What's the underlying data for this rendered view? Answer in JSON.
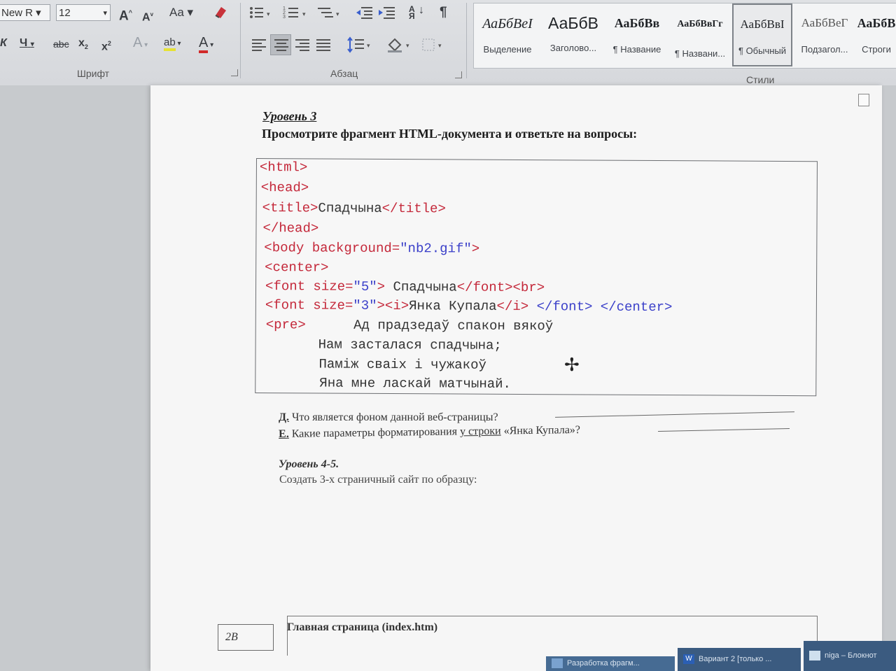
{
  "ribbon": {
    "font_name": "New R",
    "font_size": "12",
    "grow_font": "A",
    "shrink_font": "A",
    "change_case": "Aa",
    "underline": "Ч",
    "strike": "abc",
    "subscript": "x",
    "superscript": "x",
    "text_effects": "A",
    "highlight": "ab",
    "font_color": "A",
    "pilcrow": "¶",
    "font_group_label": "Шрифт",
    "paragraph_group_label": "Абзац",
    "styles_group_label": "Стили",
    "styles": [
      {
        "sample": "АаБбВеI",
        "name": "Выделение"
      },
      {
        "sample": "АаБбВ",
        "name": "Заголово..."
      },
      {
        "sample": "АаБбВв",
        "name": "¶ Название"
      },
      {
        "sample": "АаБбВвГг",
        "name": "¶ Названи..."
      },
      {
        "sample": "АаБбВвI",
        "name": "¶ Обычный"
      },
      {
        "sample": "АаБбВеГ",
        "name": "Подзагол..."
      },
      {
        "sample": "АаБбВ",
        "name": "Строги"
      }
    ]
  },
  "document": {
    "level3": "Уровень 3",
    "instruction": "Просмотрите фрагмент HTML-документа   и ответьте на вопросы:",
    "code": {
      "l1_tag": "<html>",
      "l2_tag": "<head>",
      "l3_open": "<title>",
      "l3_text": "Спадчына",
      "l3_close": "</title>",
      "l4_tag": "</head>",
      "l5_open": "<body ",
      "l5_attr": "background=",
      "l5_val": "\"nb2.gif\"",
      "l5_close": ">",
      "l6_tag": "<center>",
      "l7_open": "<font ",
      "l7_attr": "size=",
      "l7_val": "\"5\"",
      "l7_gt": ">",
      "l7_text": " Спадчына",
      "l7_close": "</font><br>",
      "l8_open": "<font ",
      "l8_attr": "size=",
      "l8_val": "\"3\"",
      "l8_gt": "><i>",
      "l8_text": "Янка Купала",
      "l8_close1": "</i>",
      "l8_close2": " </font> </center>",
      "l9_tag": "<pre>",
      "l9_text": "      Ад прадзедаў спакон вякоў",
      "l10_text": "     Нам засталася спадчына;",
      "l11_text": "     Паміж сваіх і чужакоў",
      "l12_text": "     Яна мне ласкай матчынай."
    },
    "q_d_num": "Д.",
    "q_d_text": " Что является фоном данной веб-страницы?",
    "q_e_num": "Е.",
    "q_e_text_before": " Какие параметры форматирования ",
    "q_e_text_underlined": "у  строки",
    "q_e_text_after": "  «Янка Купала»?",
    "level45": "Уровень 4-5.",
    "create_task": "Создать 3-х страничный сайт по образцу:",
    "page_box": "2В",
    "main_page": "Главная страница (index.htm)"
  },
  "taskbar": {
    "tasks": [
      "Разработка фрагм...",
      "Вариант 2 [только ...",
      "niga – Блокнот"
    ]
  }
}
